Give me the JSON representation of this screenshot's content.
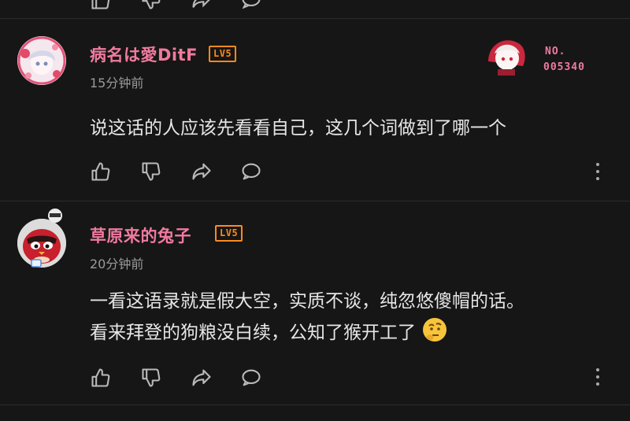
{
  "comments": [
    {
      "username": "病名は愛DitF",
      "level": "LV5",
      "timestamp": "15分钟前",
      "lines": [
        "说这话的人应该先看看自己，这几个词做到了哪一个"
      ],
      "nameplate": {
        "label": "NO.",
        "number": "005340"
      }
    },
    {
      "username": "草原来的兔子",
      "level": "LV5",
      "timestamp": "20分钟前",
      "lines": [
        "一看这语录就是假大空，实质不谈，纯忽悠傻帽的话。",
        "看来拜登的狗粮没白续，公知了猴开工了"
      ],
      "emoji": "thinking-face-emoji"
    }
  ],
  "colors": {
    "background": "#161616",
    "username": "#f07aa0",
    "level_badge": "#ff8a1e",
    "timestamp": "#9a9a9a",
    "icon": "#b9b9b9"
  },
  "icons": [
    "like-icon",
    "dislike-icon",
    "share-icon",
    "reply-icon",
    "more-options-icon"
  ]
}
